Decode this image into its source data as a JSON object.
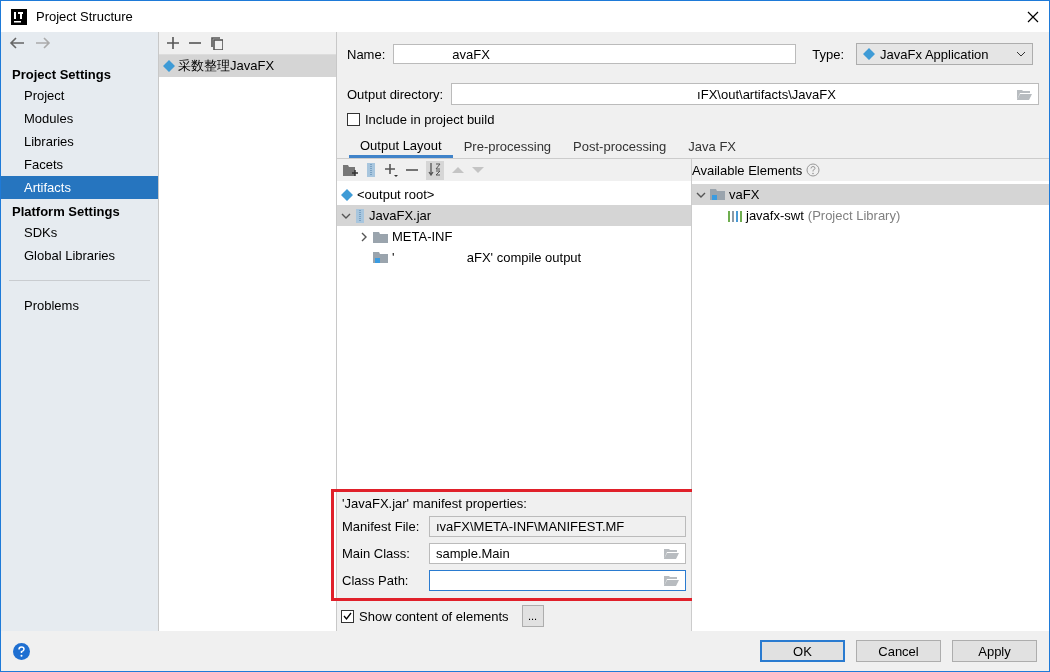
{
  "window": {
    "title": "Project Structure"
  },
  "sidebar": {
    "sections": [
      {
        "title": "Project Settings",
        "items": [
          {
            "label": "Project",
            "selected": false
          },
          {
            "label": "Modules",
            "selected": false
          },
          {
            "label": "Libraries",
            "selected": false
          },
          {
            "label": "Facets",
            "selected": false
          },
          {
            "label": "Artifacts",
            "selected": true
          }
        ]
      },
      {
        "title": "Platform Settings",
        "items": [
          {
            "label": "SDKs",
            "selected": false
          },
          {
            "label": "Global Libraries",
            "selected": false
          }
        ]
      }
    ],
    "extra_items": [
      {
        "label": "Problems",
        "selected": false
      }
    ]
  },
  "artifacts_list": {
    "items": [
      {
        "label": "采数整理JavaFX",
        "selected": true
      }
    ]
  },
  "form": {
    "name": {
      "label": "Name:",
      "value": "avaFX"
    },
    "type": {
      "label": "Type:",
      "value": "JavaFx Application"
    },
    "output_directory": {
      "label": "Output directory:",
      "value": "ıFX\\out\\artifacts\\JavaFX"
    },
    "include_in_build": {
      "label": "Include in project build",
      "checked": false
    }
  },
  "tabs": [
    {
      "label": "Output Layout",
      "selected": true
    },
    {
      "label": "Pre-processing",
      "selected": false
    },
    {
      "label": "Post-processing",
      "selected": false
    },
    {
      "label": "Java FX",
      "selected": false
    }
  ],
  "output_layout": {
    "tree": [
      {
        "label": "<output root>",
        "kind": "root",
        "selected": false
      },
      {
        "label": "JavaFX.jar",
        "kind": "archive",
        "selected": true,
        "expanded": true,
        "children": [
          {
            "label": "META-INF",
            "kind": "folder",
            "selected": false,
            "expanded": false
          },
          {
            "label": "'                    aFX' compile output",
            "kind": "module_output",
            "selected": false
          }
        ]
      }
    ]
  },
  "manifest": {
    "title": "'JavaFX.jar' manifest properties:",
    "fields": [
      {
        "label": "Manifest File:",
        "value": "ıvaFX\\META-INF\\MANIFEST.MF",
        "editable": false,
        "focused": false
      },
      {
        "label": "Main Class:",
        "value": "sample.Main",
        "editable": true,
        "focused": false
      },
      {
        "label": "Class Path:",
        "editable": true,
        "focused": true
      }
    ]
  },
  "show_content": {
    "label": "Show content of elements",
    "checked": true,
    "button": "..."
  },
  "available": {
    "title": "Available Elements",
    "tree": [
      {
        "label": "vaFX",
        "kind": "module",
        "selected": true,
        "expanded": true,
        "children": [
          {
            "label": "javafx-swt",
            "note": "(Project Library)",
            "kind": "library",
            "selected": false
          }
        ]
      }
    ]
  },
  "buttons": [
    {
      "label": "OK",
      "default": true
    },
    {
      "label": "Cancel",
      "default": false
    },
    {
      "label": "Apply",
      "default": false
    }
  ]
}
